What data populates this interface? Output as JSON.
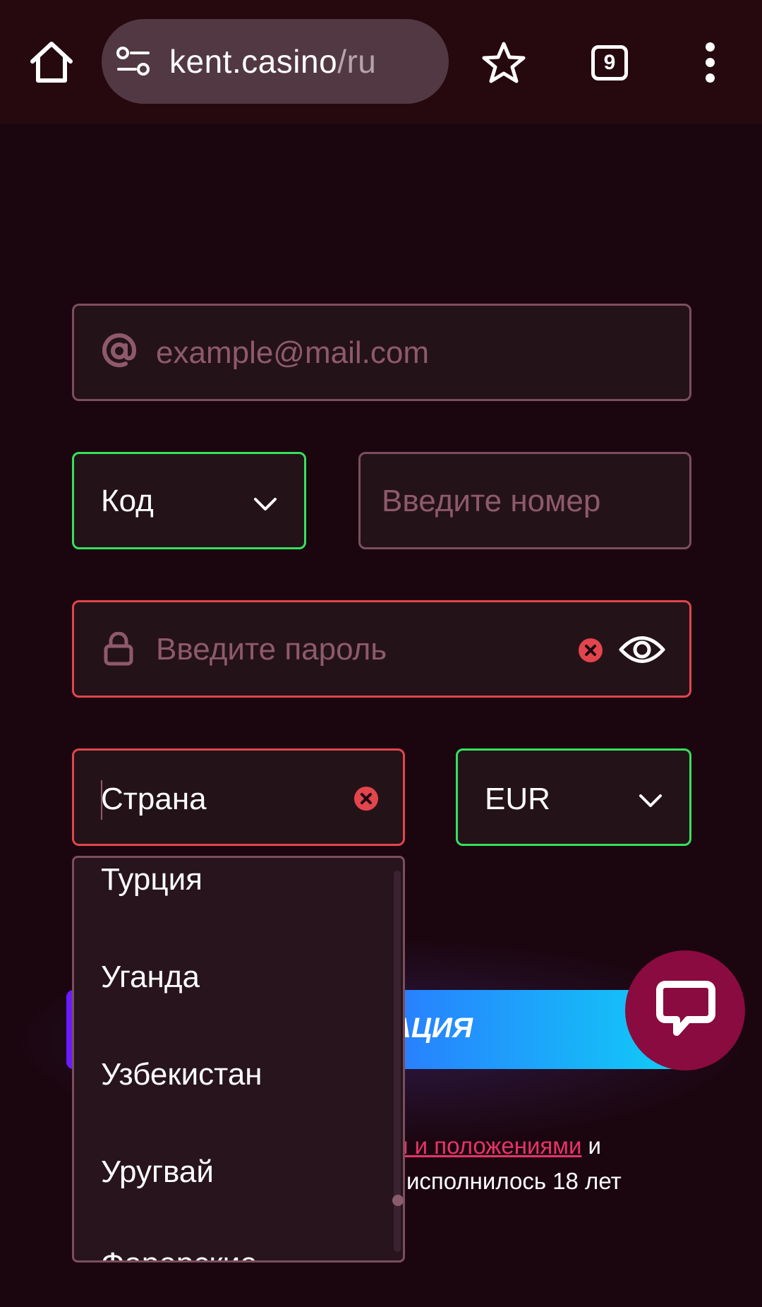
{
  "browser": {
    "url_host": "kent.casino",
    "url_path": "/ru",
    "tabs_count": "9"
  },
  "form": {
    "email_placeholder": "example@mail.com",
    "code_label": "Код",
    "phone_placeholder": "Введите номер",
    "password_placeholder": "Введите пароль",
    "country_value": "Страна",
    "currency_value": "EUR"
  },
  "country_dropdown": {
    "items": [
      "Турция",
      "Уганда",
      "Узбекистан",
      "Уругвай",
      "Фарерские"
    ]
  },
  "register": {
    "label_visible": "АЦИЯ"
  },
  "terms": {
    "link_visible": "и и положениями",
    "after_link": " и",
    "line2": "исполнилось 18 лет"
  },
  "colors": {
    "accent_ok": "#35e25a",
    "accent_error": "#e2454c",
    "chat_bg": "#8a0b3f",
    "link": "#e8336a"
  }
}
